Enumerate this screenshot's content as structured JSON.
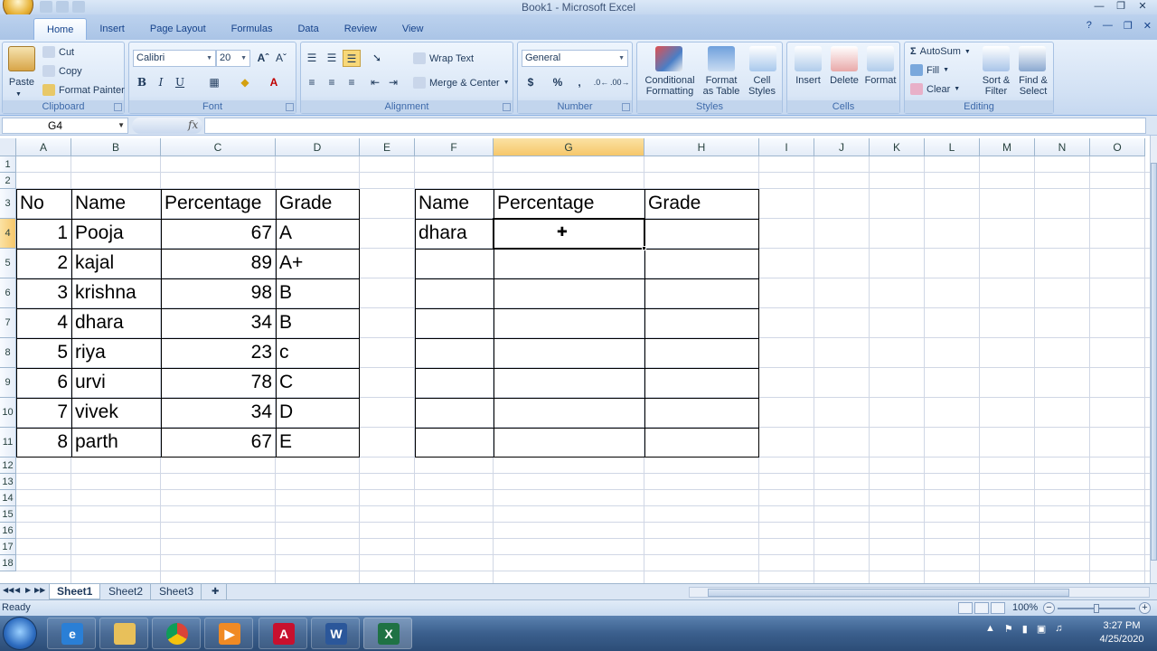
{
  "window": {
    "title": "Book1 - Microsoft Excel"
  },
  "tabs": [
    "Home",
    "Insert",
    "Page Layout",
    "Formulas",
    "Data",
    "Review",
    "View"
  ],
  "ribbon": {
    "clipboard": {
      "label": "Clipboard",
      "paste": "Paste",
      "cut": "Cut",
      "copy": "Copy",
      "format_painter": "Format Painter"
    },
    "font": {
      "label": "Font",
      "font_name": "Calibri",
      "font_size": "20",
      "bold": "B",
      "italic": "I",
      "underline": "U"
    },
    "alignment": {
      "label": "Alignment",
      "wrap_text": "Wrap Text",
      "merge_center": "Merge & Center"
    },
    "number": {
      "label": "Number",
      "format": "General",
      "currency": "$",
      "percent": "%",
      "comma": ","
    },
    "styles": {
      "label": "Styles",
      "conditional_formatting": [
        "Conditional",
        "Formatting"
      ],
      "format_as_table": [
        "Format",
        "as Table"
      ],
      "cell_styles": [
        "Cell",
        "Styles"
      ]
    },
    "cells": {
      "label": "Cells",
      "insert": "Insert",
      "delete": "Delete",
      "format": "Format"
    },
    "editing": {
      "label": "Editing",
      "autosum": "AutoSum",
      "fill": "Fill",
      "clear": "Clear",
      "sort_filter": [
        "Sort &",
        "Filter"
      ],
      "find_select": [
        "Find &",
        "Select"
      ]
    }
  },
  "formula_bar": {
    "name_box": "G4",
    "fx": "fx",
    "formula": ""
  },
  "columns": [
    "A",
    "B",
    "C",
    "D",
    "E",
    "F",
    "G",
    "H",
    "I",
    "J",
    "K",
    "L",
    "M",
    "N",
    "O"
  ],
  "rows": [
    "1",
    "2",
    "3",
    "4",
    "5",
    "6",
    "7",
    "8",
    "9",
    "10",
    "11",
    "12",
    "13",
    "14",
    "15",
    "16",
    "17",
    "18"
  ],
  "selected": {
    "column": "G",
    "row": "4"
  },
  "table1": {
    "headers": [
      "No",
      "Name",
      "Percentage",
      "Grade"
    ],
    "rows": [
      [
        "1",
        "Pooja",
        "67",
        "A"
      ],
      [
        "2",
        "kajal",
        "89",
        "A+"
      ],
      [
        "3",
        "krishna",
        "98",
        "B"
      ],
      [
        "4",
        "dhara",
        "34",
        "B"
      ],
      [
        "5",
        "riya",
        "23",
        "c"
      ],
      [
        "6",
        "urvi",
        "78",
        "C"
      ],
      [
        "7",
        "vivek",
        "34",
        "D"
      ],
      [
        "8",
        "parth",
        "67",
        "E"
      ]
    ]
  },
  "table2": {
    "headers": [
      "Name",
      "Percentage",
      "Grade"
    ],
    "rows": [
      [
        "dhara",
        "",
        ""
      ],
      [
        "",
        "",
        ""
      ],
      [
        "",
        "",
        ""
      ],
      [
        "",
        "",
        ""
      ],
      [
        "",
        "",
        ""
      ],
      [
        "",
        "",
        ""
      ],
      [
        "",
        "",
        ""
      ]
    ]
  },
  "sheets": [
    "Sheet1",
    "Sheet2",
    "Sheet3"
  ],
  "active_sheet": "Sheet1",
  "status": {
    "text": "Ready",
    "zoom": "100%"
  },
  "taskbar": {
    "time": "3:27 PM",
    "date": "4/25/2020"
  },
  "colors": {
    "accent": "#15428b",
    "selection_header": "#f6c76a",
    "excel_green": "#1f7244"
  }
}
